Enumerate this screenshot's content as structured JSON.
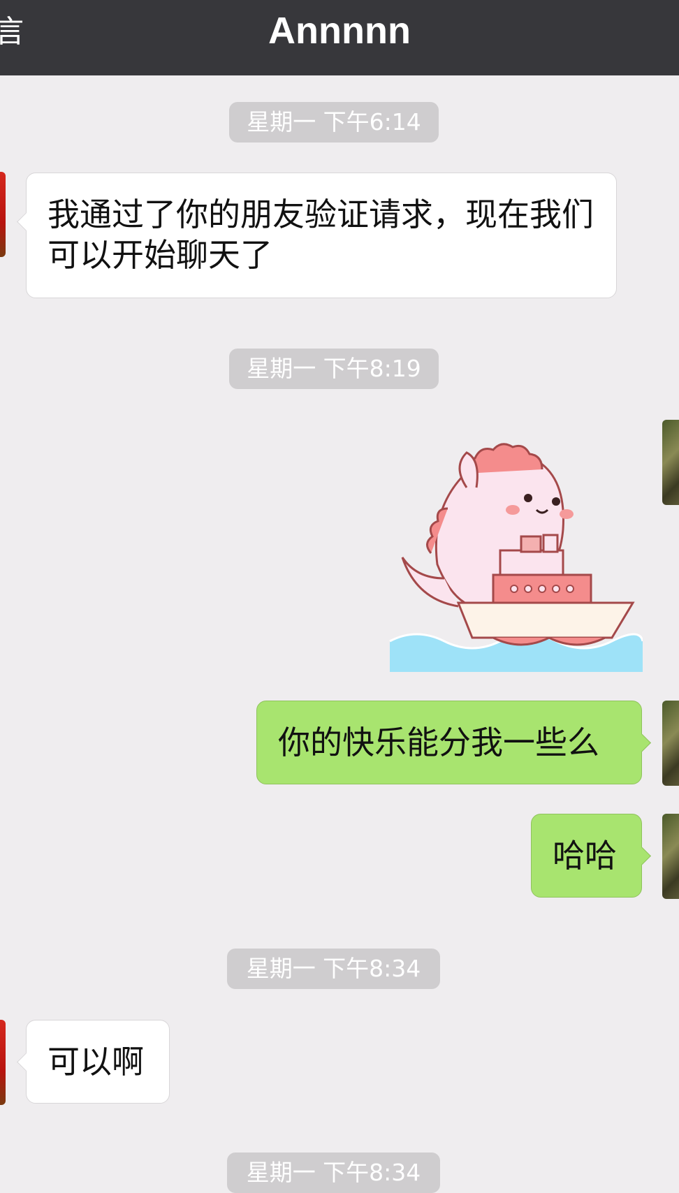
{
  "header": {
    "back_label": "言",
    "title": "Annnnn"
  },
  "messages": [
    {
      "type": "timestamp",
      "text": "星期一 下午6:14"
    },
    {
      "type": "text",
      "direction": "in",
      "text": "我通过了你的朋友验证请求，现在我们可以开始聊天了"
    },
    {
      "type": "timestamp",
      "text": "星期一 下午8:19"
    },
    {
      "type": "sticker",
      "direction": "out",
      "icon": "pink-dinosaur-on-boat-sticker"
    },
    {
      "type": "text",
      "direction": "out",
      "text": "你的快乐能分我一些么"
    },
    {
      "type": "text",
      "direction": "out",
      "text": "哈哈"
    },
    {
      "type": "timestamp",
      "text": "星期一 下午8:34"
    },
    {
      "type": "text",
      "direction": "in",
      "text": "可以啊"
    },
    {
      "type": "timestamp",
      "text": "星期一 下午8:34"
    }
  ],
  "colors": {
    "header_bg": "#37373b",
    "chat_bg": "#efedef",
    "incoming_bubble": "#ffffff",
    "outgoing_bubble": "#a8e46f",
    "timestamp_bg": "#cfcdcf"
  }
}
